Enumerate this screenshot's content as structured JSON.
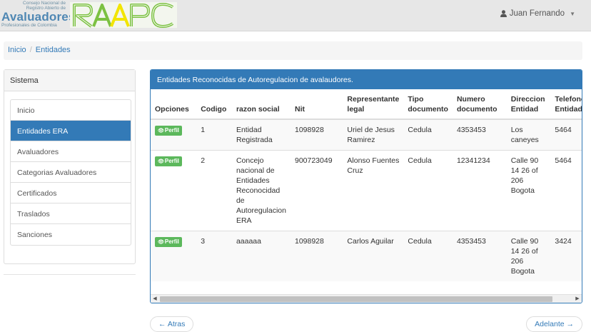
{
  "header": {
    "logo_line1": "Consejo Nacional de",
    "logo_line2": "Registro Abierto de",
    "logo_big": "Avaluadores",
    "logo_line3": "Profesionales de Colombia",
    "logo_mark": "RAAPC",
    "user_name": "Juan Fernando",
    "user_icon": "user-icon"
  },
  "breadcrumb": {
    "home": "Inicio",
    "current": "Entidades"
  },
  "sidebar": {
    "title": "Sistema",
    "items": [
      {
        "label": "Inicio"
      },
      {
        "label": "Entidades ERA"
      },
      {
        "label": "Avaluadores"
      },
      {
        "label": "Categorias Avaluadores"
      },
      {
        "label": "Certificados"
      },
      {
        "label": "Traslados"
      },
      {
        "label": "Sanciones"
      }
    ]
  },
  "panel": {
    "title": "Entidades Reconocidas de Autoregulacion de avalaudores."
  },
  "table": {
    "headers": [
      "Opciones",
      "Codigo",
      "razon social",
      "Nit",
      "Representante legal",
      "Tipo documento",
      "Numero documento",
      "Direccion Entidad",
      "Telefono Entidad"
    ],
    "button_label": "Perfil",
    "rows": [
      {
        "codigo": "1",
        "razon": "Entidad Registrada",
        "nit": "1098928",
        "rep": "Uriel de Jesus Ramirez",
        "tipo": "Cedula",
        "numero": "4353453",
        "direccion": "Los caneyes",
        "telefono": "5464"
      },
      {
        "codigo": "2",
        "razon": "Concejo nacional de Entidades Reconocidad de Autoregulacion ERA",
        "nit": "900723049",
        "rep": "Alonso Fuentes Cruz",
        "tipo": "Cedula",
        "numero": "12341234",
        "direccion": "Calle 90 14 26 of 206 Bogota",
        "telefono": "5464"
      },
      {
        "codigo": "3",
        "razon": "aaaaaa",
        "nit": "1098928",
        "rep": "Carlos Aguilar",
        "tipo": "Cedula",
        "numero": "4353453",
        "direccion": "Calle 90 14 26 of 206 Bogota",
        "telefono": "3424"
      }
    ]
  },
  "pager": {
    "prev": "← Atras",
    "next": "Adelante →"
  },
  "colors": {
    "primary": "#337ab7",
    "success": "#5cb85c",
    "logo_green": "#7cc142",
    "logo_yellow": "#f2e500"
  }
}
